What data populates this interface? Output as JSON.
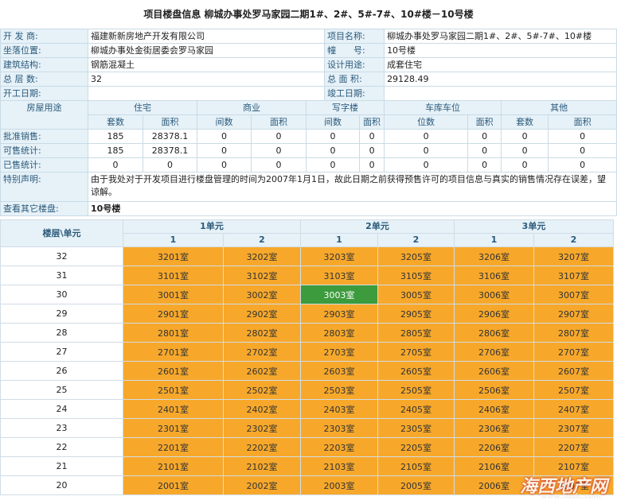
{
  "page_title": "项目楼盘信息  柳城办事处罗马家园二期1#、2#、5#-7#、10#楼－10号楼",
  "project": {
    "developer_label": "开 发 商:",
    "developer": "福建新新房地产开发有限公司",
    "project_name_label": "项目名称:",
    "project_name": "柳城办事处罗马家园二期1#、2#、5#-7#、10#楼",
    "location_label": "坐落位置:",
    "location": "柳城办事处金街居委会罗马家园",
    "building_no_label": "幢　　号:",
    "building_no": "10号楼",
    "structure_label": "建筑结构:",
    "structure": "钢筋混凝土",
    "usage_label": "设计用途:",
    "usage": "成套住宅",
    "floors_label": "总 层 数:",
    "floors": "32",
    "area_label": "总 面 积:",
    "area": "29128.49",
    "start_label": "开工日期:",
    "start": "",
    "finish_label": "竣工日期:",
    "finish": ""
  },
  "stats": {
    "use_label": "房屋用途",
    "categories": [
      "住宅",
      "商业",
      "写字楼",
      "车库车位",
      "其他"
    ],
    "subheaders": [
      "套数",
      "面积",
      "间数",
      "面积",
      "间数",
      "面积",
      "位数",
      "面积",
      "套数",
      "面积"
    ],
    "rows": [
      {
        "label": "批准销售:",
        "values": [
          "185",
          "28378.1",
          "0",
          "0",
          "0",
          "0",
          "0",
          "0",
          "0",
          "0"
        ]
      },
      {
        "label": "可售统计:",
        "values": [
          "185",
          "28378.1",
          "0",
          "0",
          "0",
          "0",
          "0",
          "0",
          "0",
          "0"
        ]
      },
      {
        "label": "已售统计:",
        "values": [
          "0",
          "0",
          "0",
          "0",
          "0",
          "0",
          "0",
          "0",
          "0",
          "0"
        ]
      }
    ],
    "notice_label": "特别声明:",
    "notice": "由于我处对于开发项目进行楼盘管理的时间为2007年1月1日，故此日期之前获得预售许可的项目信息与真实的销售情况存在误差，望谅解。",
    "other_label": "查看其它楼盘:",
    "other_link": "10号楼"
  },
  "table": {
    "corner_label": "楼层\\单元",
    "units": [
      "1单元",
      "2单元",
      "3单元"
    ],
    "sub_units": [
      "1",
      "2",
      "1",
      "2",
      "1",
      "2"
    ],
    "floors": [
      {
        "floor": "32",
        "rooms": [
          "3201室",
          "3202室",
          "3203室",
          "3205室",
          "3206室",
          "3207室"
        ]
      },
      {
        "floor": "31",
        "rooms": [
          "3101室",
          "3102室",
          "3103室",
          "3105室",
          "3106室",
          "3107室"
        ]
      },
      {
        "floor": "30",
        "rooms": [
          "3001室",
          "3002室",
          "3003室",
          "3005室",
          "3006室",
          "3007室"
        ]
      },
      {
        "floor": "29",
        "rooms": [
          "2901室",
          "2902室",
          "2903室",
          "2905室",
          "2906室",
          "2907室"
        ]
      },
      {
        "floor": "28",
        "rooms": [
          "2801室",
          "2802室",
          "2803室",
          "2805室",
          "2806室",
          "2807室"
        ]
      },
      {
        "floor": "27",
        "rooms": [
          "2701室",
          "2702室",
          "2703室",
          "2705室",
          "2706室",
          "2707室"
        ]
      },
      {
        "floor": "26",
        "rooms": [
          "2601室",
          "2602室",
          "2603室",
          "2605室",
          "2606室",
          "2607室"
        ]
      },
      {
        "floor": "25",
        "rooms": [
          "2501室",
          "2502室",
          "2503室",
          "2505室",
          "2506室",
          "2507室"
        ]
      },
      {
        "floor": "24",
        "rooms": [
          "2401室",
          "2402室",
          "2403室",
          "2405室",
          "2406室",
          "2407室"
        ]
      },
      {
        "floor": "23",
        "rooms": [
          "2301室",
          "2302室",
          "2303室",
          "2305室",
          "2306室",
          "2307室"
        ]
      },
      {
        "floor": "22",
        "rooms": [
          "2201室",
          "2202室",
          "2203室",
          "2205室",
          "2206室",
          "2207室"
        ]
      },
      {
        "floor": "21",
        "rooms": [
          "2101室",
          "2102室",
          "2103室",
          "2105室",
          "2106室",
          "2107室"
        ]
      },
      {
        "floor": "20",
        "rooms": [
          "2001室",
          "2002室",
          "2003室",
          "2005室",
          "2006室",
          "2007室"
        ]
      }
    ],
    "highlighted_room": "3003室",
    "colors": {
      "available": "#f7a82b",
      "highlighted": "#3c9b3c"
    }
  },
  "watermark": {
    "logo": "海西地产网",
    "url": "www.hxdc.com"
  }
}
